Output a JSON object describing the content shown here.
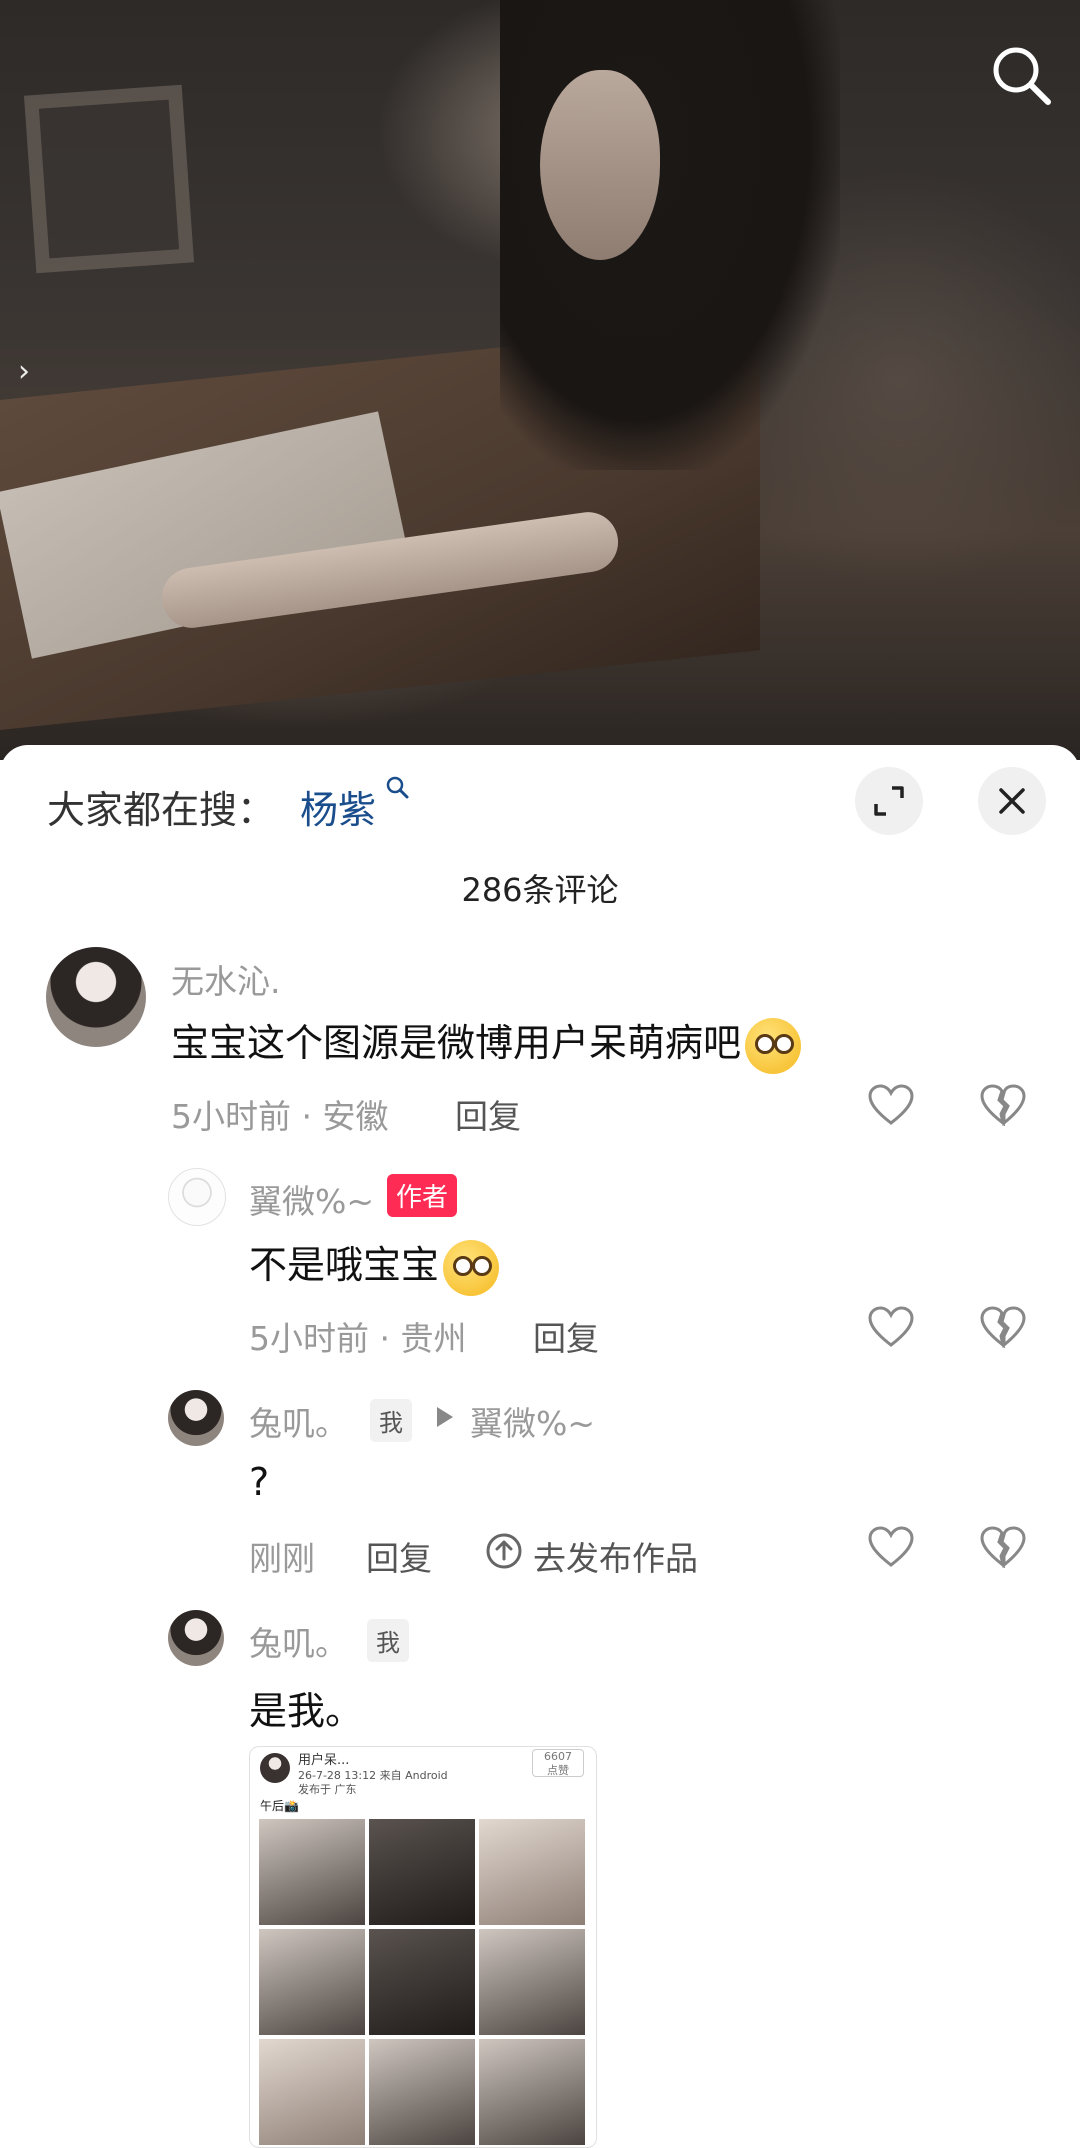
{
  "hot_search": {
    "prefix": "大家都在搜：",
    "term": "杨紫"
  },
  "comment_count": "286条评论",
  "comments": [
    {
      "username": "无水沁.",
      "text": "宝宝这个图源是微博用户呆萌病吧",
      "emoji": "thinking-face",
      "time_location": "5小时前 · 安徽",
      "reply_label": "回复"
    },
    {
      "username": "翼微%~",
      "tag": "作者",
      "text": "不是哦宝宝",
      "emoji": "thinking-face",
      "time_location": "5小时前 · 贵州",
      "reply_label": "回复"
    },
    {
      "username": "兔叽。",
      "tag": "我",
      "reply_to": "翼微%~",
      "text": "?",
      "time_location": "刚刚",
      "reply_label": "回复",
      "publish_label": "去发布作品"
    },
    {
      "username": "兔叽。",
      "tag": "我",
      "text": "是我。",
      "image": {
        "header_user": "用户呆...",
        "header_time": "26-7-28 13:12  来自 Android",
        "header_location": "发布于 广东",
        "header_count": "6607",
        "header_count_label": "点赞",
        "caption": "午后📸"
      }
    }
  ],
  "colors": {
    "accent": "#fe2c55",
    "hot_term": "#1a4d8c",
    "meta": "#999999"
  }
}
